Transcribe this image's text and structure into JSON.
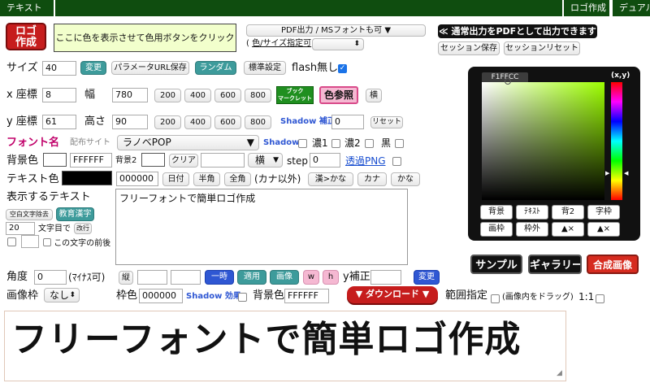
{
  "topbar": {
    "tab_text": "テキスト",
    "tab_logo": "ロゴ作成",
    "tab_dual": "デュアル"
  },
  "logo_badge": {
    "line1": "ロゴ",
    "line2": "作成"
  },
  "color_hint": "ここに色を表示させて色用ボタンをクリック",
  "pdf": {
    "select_label": "PDF出力 / MSフォントも可 ▼",
    "size_label": "色/サイズ指定可"
  },
  "output": {
    "banner": "≪ 通常出力をPDFとして出力できます",
    "session_save": "セッション保存",
    "session_reset": "セッションリセット"
  },
  "size_row": {
    "label": "サイズ",
    "value": "40",
    "change": "変更",
    "param_url": "パラメータURL保存",
    "random": "ランダム",
    "standard": "標準設定",
    "no_flash": "flash無し"
  },
  "x_row": {
    "label": "x 座標",
    "x_value": "8",
    "width_label": "幅",
    "width_value": "780",
    "presets": [
      "200",
      "400",
      "600",
      "800"
    ],
    "bookmarklet_1": "ブック",
    "bookmarklet_2": "マークレット",
    "color_ref": "色参照",
    "horizontal": "横"
  },
  "y_row": {
    "label": "y 座標",
    "y_value": "61",
    "height_label": "高さ",
    "height_value": "90",
    "presets": [
      "200",
      "400",
      "600",
      "800"
    ],
    "shadow_fix": "Shadow 補正",
    "shadow_value": "0",
    "reset": "リセット"
  },
  "font_row": {
    "label": "フォント名",
    "dist_site": "配布サイト",
    "font_value": "ラノベPOP",
    "shadow": "Shadow",
    "dark1": "濃1",
    "dark2": "濃2",
    "black": "黒"
  },
  "bg_row": {
    "label": "背景色",
    "color_value": "FFFFFF",
    "bg2": "背景2",
    "clear": "クリア",
    "orient": "横",
    "step": "step",
    "step_value": "0",
    "transparent": "透過PNG"
  },
  "text_color_row": {
    "label": "テキスト色",
    "value": "000000",
    "date": "日付",
    "halfwidth": "半角",
    "fullwidth": "全角",
    "kana_note": "(カナ以外)",
    "kan2kana": "漢>かな",
    "katakana": "カナ",
    "hiragana": "かな"
  },
  "text_area": {
    "label": "表示するテキスト",
    "remove_space": "空白文字除去",
    "edu_kanji": "教育漢字",
    "wrap_value": "20",
    "wrap_label": "文字目で",
    "wrap_btn": "改行",
    "before_label": "この文字の前後",
    "content": "フリーフォントで簡単ロゴ作成"
  },
  "palette": {
    "hex": "F1FFCC",
    "xy": "(x,y)",
    "buttons": [
      "背景",
      "ﾃｷｽﾄ",
      "背2",
      "字枠",
      "画枠",
      "枠外",
      "▲×",
      "▲×"
    ]
  },
  "actions": {
    "sample": "サンプル",
    "gallery": "ギャラリー",
    "compose": "合成画像"
  },
  "angle_row": {
    "label": "角度",
    "value": "0",
    "unit": "(ﾏｲﾅｽ可)",
    "vertical": "縦",
    "temp": "一時",
    "apply": "適用",
    "image": "画像",
    "w": "w",
    "h": "h",
    "y_fix": "y補正",
    "change": "変更"
  },
  "frame_row": {
    "label": "画像枠",
    "frame_value": "なし",
    "border_label": "枠色",
    "border_value": "000000",
    "shadow_effect": "Shadow 効果",
    "bg_label": "背景色",
    "bg_value": "FFFFFF",
    "download": "▼ ダウンロード ▼",
    "range": "範囲指定",
    "drag_note": "(画像内をドラッグ)",
    "ratio": "1:1"
  },
  "preview_text": "フリーフォントで簡単ロゴ作成",
  "colors": {
    "topbar": "#0f4d0f",
    "teal": "#3d9b9b",
    "blue": "#2f57d3",
    "download": "#c61d1d",
    "palette_bg": "#111111",
    "picker_start": "#9dff00"
  }
}
